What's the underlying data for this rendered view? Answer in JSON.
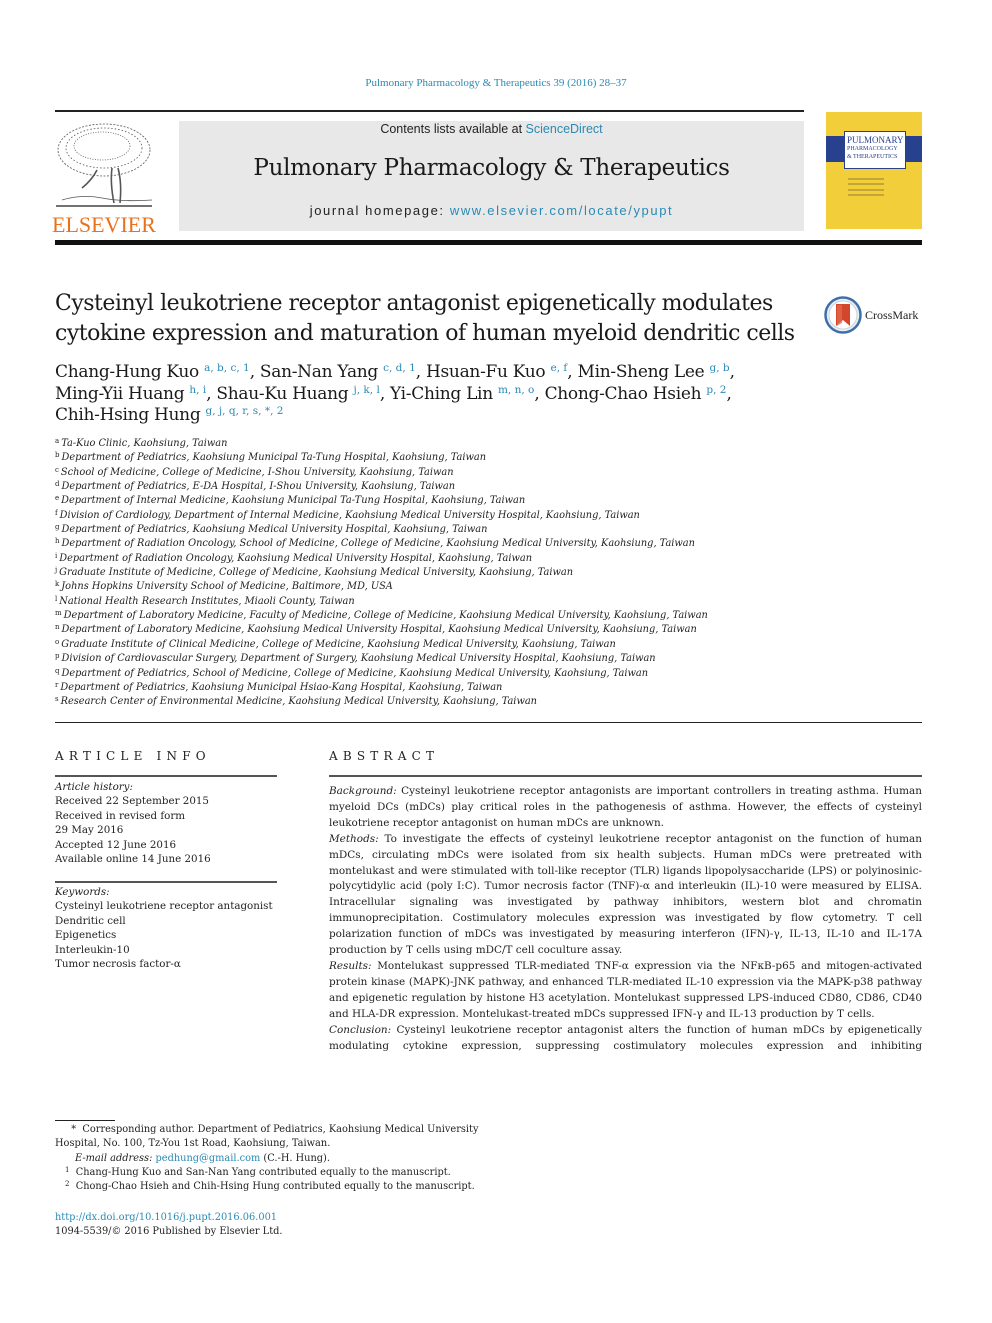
{
  "running_head": "Pulmonary Pharmacology & Therapeutics 39 (2016) 28–37",
  "publisher": {
    "logo_word": "ELSEVIER",
    "logo_color": "#e9711c",
    "link_color": "#2a8ab4"
  },
  "masthead": {
    "contents_prefix": "Contents lists available at ",
    "contents_link": "ScienceDirect",
    "journal_title": "Pulmonary Pharmacology & Therapeutics",
    "homepage_prefix": "journal homepage: ",
    "homepage_link": "www.elsevier.com/locate/ypupt"
  },
  "cover": {
    "title_line1": "PULMONARY",
    "title_line2": "PHARMACOLOGY",
    "title_line3": "& THERAPEUTICS",
    "background_color": "#f2cf3a",
    "band_color": "#27418f"
  },
  "article": {
    "title_line1": "Cysteinyl leukotriene receptor antagonist epigenetically modulates",
    "title_line2": "cytokine expression and maturation of human myeloid dendritic cells",
    "crossmark_label": "CrossMark"
  },
  "authors": [
    {
      "name": "Chang-Hung Kuo",
      "sup": "a, b, c, 1",
      "sep": ", "
    },
    {
      "name": "San-Nan Yang",
      "sup": "c, d, 1",
      "sep": ", "
    },
    {
      "name": "Hsuan-Fu Kuo",
      "sup": "e, f",
      "sep": ", "
    },
    {
      "name": "Min-Sheng Lee",
      "sup": "g, b",
      "sep": ","
    },
    {
      "name": "Ming-Yii Huang",
      "sup": "h, i",
      "sep": ", "
    },
    {
      "name": "Shau-Ku Huang",
      "sup": "j, k, l",
      "sep": ", "
    },
    {
      "name": "Yi-Ching Lin",
      "sup": "m, n, o",
      "sep": ", "
    },
    {
      "name": "Chong-Chao Hsieh",
      "sup": "p, 2",
      "sep": ","
    },
    {
      "name": "Chih-Hsing Hung",
      "sup": "g, j, q, r, s, *, 2",
      "sep": ""
    }
  ],
  "affiliations": [
    {
      "key": "a",
      "text": "Ta-Kuo Clinic, Kaohsiung, Taiwan"
    },
    {
      "key": "b",
      "text": "Department of Pediatrics, Kaohsiung Municipal Ta-Tung Hospital, Kaohsiung, Taiwan"
    },
    {
      "key": "c",
      "text": "School of Medicine, College of Medicine, I-Shou University, Kaohsiung, Taiwan"
    },
    {
      "key": "d",
      "text": "Department of Pediatrics, E-DA Hospital, I-Shou University, Kaohsiung, Taiwan"
    },
    {
      "key": "e",
      "text": "Department of Internal Medicine, Kaohsiung Municipal Ta-Tung Hospital, Kaohsiung, Taiwan"
    },
    {
      "key": "f",
      "text": "Division of Cardiology, Department of Internal Medicine, Kaohsiung Medical University Hospital, Kaohsiung, Taiwan"
    },
    {
      "key": "g",
      "text": "Department of Pediatrics, Kaohsiung Medical University Hospital, Kaohsiung, Taiwan"
    },
    {
      "key": "h",
      "text": "Department of Radiation Oncology, School of Medicine, College of Medicine, Kaohsiung Medical University, Kaohsiung, Taiwan"
    },
    {
      "key": "i",
      "text": "Department of Radiation Oncology, Kaohsiung Medical University Hospital, Kaohsiung, Taiwan"
    },
    {
      "key": "j",
      "text": "Graduate Institute of Medicine, College of Medicine, Kaohsiung Medical University, Kaohsiung, Taiwan"
    },
    {
      "key": "k",
      "text": "Johns Hopkins University School of Medicine, Baltimore, MD, USA"
    },
    {
      "key": "l",
      "text": "National Health Research Institutes, Miaoli County, Taiwan"
    },
    {
      "key": "m",
      "text": "Department of Laboratory Medicine, Faculty of Medicine, College of Medicine, Kaohsiung Medical University, Kaohsiung, Taiwan"
    },
    {
      "key": "n",
      "text": "Department of Laboratory Medicine, Kaohsiung Medical University Hospital, Kaohsiung Medical University, Kaohsiung, Taiwan"
    },
    {
      "key": "o",
      "text": "Graduate Institute of Clinical Medicine, College of Medicine, Kaohsiung Medical University, Kaohsiung, Taiwan"
    },
    {
      "key": "p",
      "text": "Division of Cardiovascular Surgery, Department of Surgery, Kaohsiung Medical University Hospital, Kaohsiung, Taiwan"
    },
    {
      "key": "q",
      "text": "Department of Pediatrics, School of Medicine, College of Medicine, Kaohsiung Medical University, Kaohsiung, Taiwan"
    },
    {
      "key": "r",
      "text": "Department of Pediatrics, Kaohsiung Municipal Hsiao-Kang Hospital, Kaohsiung, Taiwan"
    },
    {
      "key": "s",
      "text": "Research Center of Environmental Medicine, Kaohsiung Medical University, Kaohsiung, Taiwan"
    }
  ],
  "article_info": {
    "heading": "ARTICLE INFO",
    "history_label": "Article history:",
    "history": [
      "Received 22 September 2015",
      "Received in revised form",
      "29 May 2016",
      "Accepted 12 June 2016",
      "Available online 14 June 2016"
    ],
    "keywords_label": "Keywords:",
    "keywords": [
      "Cysteinyl leukotriene receptor antagonist",
      "Dendritic cell",
      "Epigenetics",
      "Interleukin-10",
      "Tumor necrosis factor-α"
    ]
  },
  "abstract": {
    "heading": "ABSTRACT",
    "sections": [
      {
        "label": "Background:",
        "text": "Cysteinyl leukotriene receptor antagonists are important controllers in treating asthma. Human myeloid DCs (mDCs) play critical roles in the pathogenesis of asthma. However, the effects of cysteinyl leukotriene receptor antagonist on human mDCs are unknown."
      },
      {
        "label": "Methods:",
        "text": "To investigate the effects of cysteinyl leukotriene receptor antagonist on the function of human mDCs, circulating mDCs were isolated from six health subjects. Human mDCs were pretreated with montelukast and were stimulated with toll-like receptor (TLR) ligands lipopolysaccharide (LPS) or polyinosinic-polycytidylic acid (poly I:C). Tumor necrosis factor (TNF)-α and interleukin (IL)-10 were measured by ELISA. Intracellular signaling was investigated by pathway inhibitors, western blot and chromatin immunoprecipitation. Costimulatory molecules expression was investigated by flow cytometry. T cell polarization function of mDCs was investigated by measuring interferon (IFN)-γ, IL-13, IL-10 and IL-17A production by T cells using mDC/T cell coculture assay."
      },
      {
        "label": "Results:",
        "text": "Montelukast suppressed TLR-mediated TNF-α expression via the NFκB-p65 and mitogen-activated protein kinase (MAPK)-JNK pathway, and enhanced TLR-mediated IL-10 expression via the MAPK-p38 pathway and epigenetic regulation by histone H3 acetylation. Montelukast suppressed LPS-induced CD80, CD86, CD40 and HLA-DR expression. Montelukast-treated mDCs suppressed IFN-γ and IL-13 production by T cells."
      },
      {
        "label": "Conclusion:",
        "text": "Cysteinyl leukotriene receptor antagonist alters the function of human mDCs by epigenetically modulating cytokine expression, suppressing costimulatory molecules expression and inhibiting"
      }
    ]
  },
  "footnotes": {
    "corresponding_mark": "*",
    "corresponding_text": "Corresponding author. Department of Pediatrics, Kaohsiung Medical University Hospital, No. 100, Tz-You 1st Road, Kaohsiung, Taiwan.",
    "email_label": "E-mail address:",
    "email": "pedhung@gmail.com",
    "email_suffix": " (C.-H. Hung).",
    "note1_mark": "1",
    "note1": "Chang-Hung Kuo and San-Nan Yang contributed equally to the manuscript.",
    "note2_mark": "2",
    "note2": "Chong-Chao Hsieh and Chih-Hsing Hung contributed equally to the manuscript."
  },
  "doi": {
    "link": "http://dx.doi.org/10.1016/j.pupt.2016.06.001",
    "issn_copyright": "1094-5539/© 2016 Published by Elsevier Ltd."
  }
}
